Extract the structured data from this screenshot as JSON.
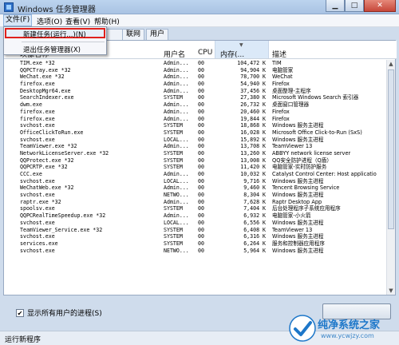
{
  "window": {
    "title": "Windows 任务管理器"
  },
  "menubar": {
    "items": [
      "文件(F)",
      "选项(O)",
      "查看(V)",
      "帮助(H)"
    ]
  },
  "tabs": [
    "联网",
    "用户"
  ],
  "file_menu": {
    "items": [
      "新建任务(运行...)(N)",
      "退出任务管理器(X)"
    ]
  },
  "table": {
    "columns": [
      "映像名称",
      "用户名",
      "CPU",
      "内存(...",
      "描述"
    ],
    "rows": [
      [
        "TIM.exe *32",
        "Admin...",
        "00",
        "104,472 K",
        "TIM"
      ],
      [
        "QQPCTray.exe *32",
        "Admin...",
        "00",
        "94,904 K",
        "电脑管家"
      ],
      [
        "WeChat.exe *32",
        "Admin...",
        "00",
        "78,700 K",
        "WeChat"
      ],
      [
        "firefox.exe",
        "Admin...",
        "00",
        "54,940 K",
        "Firefox"
      ],
      [
        "DesktopMgr64.exe",
        "Admin...",
        "00",
        "37,456 K",
        "桌面整理-主程序"
      ],
      [
        "SearchIndexer.exe",
        "SYSTEM",
        "00",
        "27,380 K",
        "Microsoft Windows Search 索引器"
      ],
      [
        "dwm.exe",
        "Admin...",
        "00",
        "26,732 K",
        "桌面窗口管理器"
      ],
      [
        "firefox.exe",
        "Admin...",
        "00",
        "20,460 K",
        "Firefox"
      ],
      [
        "firefox.exe",
        "Admin...",
        "00",
        "19,844 K",
        "Firefox"
      ],
      [
        "svchost.exe",
        "SYSTEM",
        "00",
        "18,868 K",
        "Windows 服务主进程"
      ],
      [
        "OfficeClickToRun.exe",
        "SYSTEM",
        "00",
        "16,028 K",
        "Microsoft Office Click-to-Run (SxS)"
      ],
      [
        "svchost.exe",
        "LOCAL...",
        "00",
        "15,892 K",
        "Windows 服务主进程"
      ],
      [
        "TeamViewer.exe *32",
        "Admin...",
        "00",
        "13,708 K",
        "TeamViewer 13"
      ],
      [
        "NetworkLicenseServer.exe *32",
        "SYSTEM",
        "00",
        "13,260 K",
        "ABBYY network license server"
      ],
      [
        "QQProtect.exe *32",
        "SYSTEM",
        "00",
        "13,008 K",
        "QQ安全防护进程（Q盾）"
      ],
      [
        "QQPCRTP.exe *32",
        "SYSTEM",
        "00",
        "11,420 K",
        "电脑管家-实时防护服务"
      ],
      [
        "CCC.exe",
        "Admin...",
        "00",
        "10,032 K",
        "Catalyst Control Center: Host applicatio"
      ],
      [
        "svchost.exe",
        "LOCAL...",
        "00",
        "9,716 K",
        "Windows 服务主进程"
      ],
      [
        "WeChatWeb.exe *32",
        "Admin...",
        "00",
        "9,460 K",
        "Tencent Browsing Service"
      ],
      [
        "svchost.exe",
        "NETWO...",
        "00",
        "8,304 K",
        "Windows 服务主进程"
      ],
      [
        "raptr.exe *32",
        "Admin...",
        "00",
        "7,628 K",
        "Raptr Desktop App"
      ],
      [
        "spoolsv.exe",
        "SYSTEM",
        "00",
        "7,404 K",
        "后台处理程序子系统应用程序"
      ],
      [
        "QQPCRealTimeSpeedup.exe *32",
        "Admin...",
        "00",
        "6,932 K",
        "电脑管家-小火箭"
      ],
      [
        "svchost.exe",
        "LOCAL...",
        "00",
        "6,556 K",
        "Windows 服务主进程"
      ],
      [
        "TeamViewer_Service.exe *32",
        "SYSTEM",
        "00",
        "6,408 K",
        "TeamViewer 13"
      ],
      [
        "svchost.exe",
        "SYSTEM",
        "00",
        "6,316 K",
        "Windows 服务主进程"
      ],
      [
        "services.exe",
        "SYSTEM",
        "00",
        "6,264 K",
        "服务和控制器应用程序"
      ],
      [
        "svchost.exe",
        "NETWO...",
        "00",
        "5,964 K",
        "Windows 服务主进程"
      ]
    ]
  },
  "show_all_users": {
    "label": "显示所有用户的进程(S)",
    "checked": true
  },
  "statusbar": {
    "text": "运行新程序"
  },
  "watermark": {
    "title": "纯净系统之家",
    "url": "www.ycwjzy.com"
  },
  "colors": {
    "highlight_border": "#e0211c",
    "brand_blue": "#1d77c9"
  }
}
